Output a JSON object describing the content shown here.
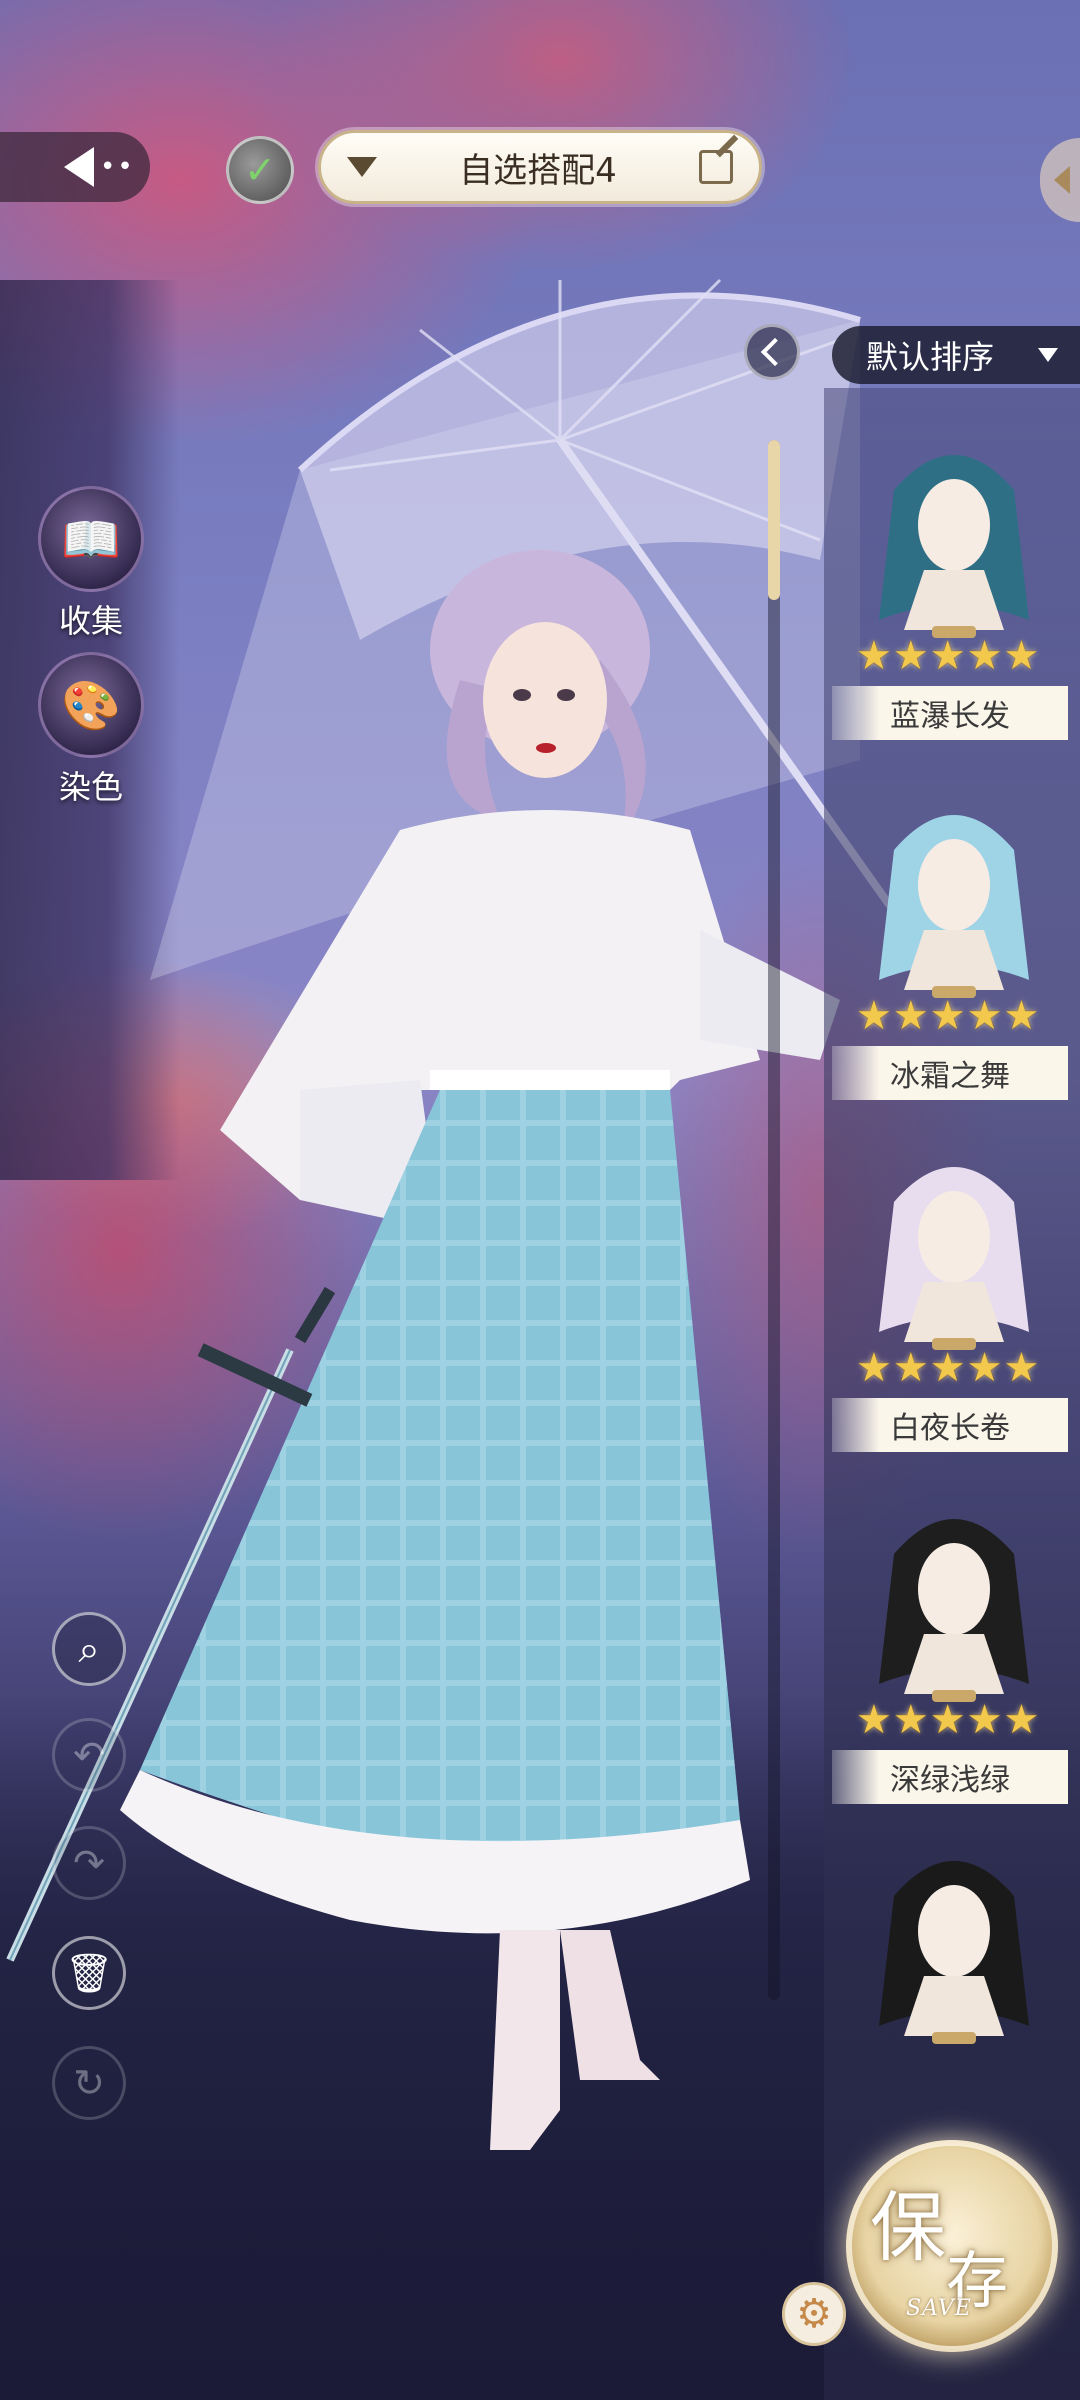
{
  "top_bar": {
    "outfit_name": "自选搭配4"
  },
  "left_menu": {
    "collect_label": "收集",
    "dye_label": "染色"
  },
  "panel": {
    "sort_label": "默认排序",
    "items": [
      {
        "name": "蓝瀑长发",
        "stars": 5,
        "hair_color": "#2f6f86"
      },
      {
        "name": "冰霜之舞",
        "stars": 5,
        "hair_color": "#9fd3e6"
      },
      {
        "name": "白夜长卷",
        "stars": 5,
        "hair_color": "#e8dcef"
      },
      {
        "name": "深绿浅绿",
        "stars": 5,
        "hair_color": "#1e1e1e"
      },
      {
        "name": "",
        "stars": 0,
        "hair_color": "#1a1a1a"
      }
    ]
  },
  "save": {
    "char1": "保",
    "char2": "存",
    "en": "SAVE"
  },
  "colors": {
    "star": "#f2c94c",
    "label_bg": "#fbf6ea",
    "accent_gold": "#c9b48a"
  }
}
